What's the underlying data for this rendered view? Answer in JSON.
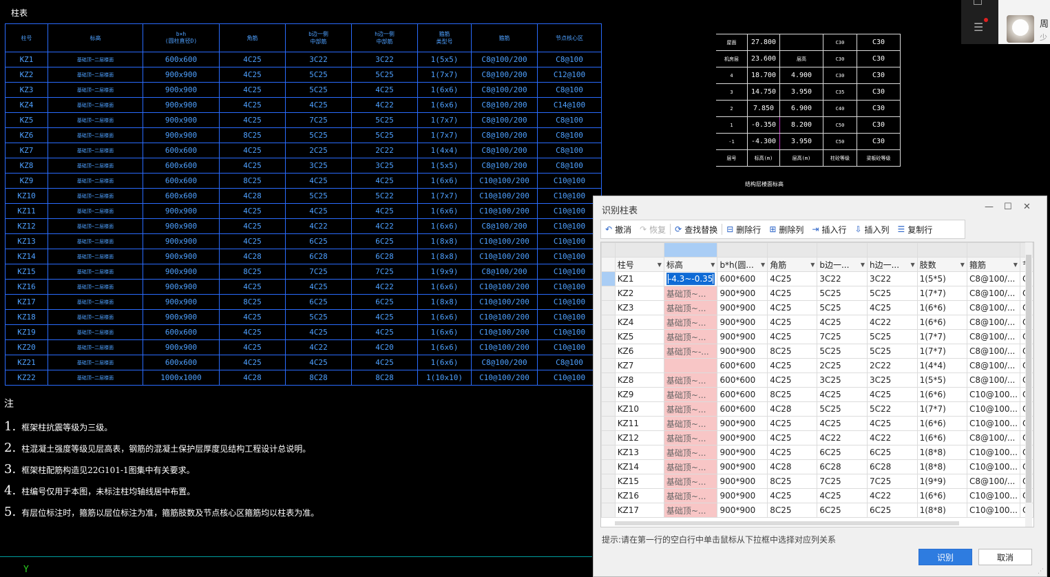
{
  "cad": {
    "title": "柱表",
    "col_headers": [
      "柱号",
      "标高",
      "b×h\n(圆柱直径D)",
      "角筋",
      "b边一侧\n中部筋",
      "h边一侧\n中部筋",
      "箍筋\n类型号",
      "箍筋",
      "节点核心区"
    ],
    "rows": [
      [
        "KZ1",
        "基础顶~二层楼面",
        "600x600",
        "4C25",
        "3C22",
        "3C22",
        "1(5x5)",
        "C8@100/200",
        "C8@100"
      ],
      [
        "KZ2",
        "基础顶~二层楼面",
        "900x900",
        "4C25",
        "5C25",
        "5C25",
        "1(7x7)",
        "C8@100/200",
        "C12@100"
      ],
      [
        "KZ3",
        "基础顶~二层楼面",
        "900x900",
        "4C25",
        "5C25",
        "4C25",
        "1(6x6)",
        "C8@100/200",
        "C8@100"
      ],
      [
        "KZ4",
        "基础顶~二层楼面",
        "900x900",
        "4C25",
        "4C25",
        "4C22",
        "1(6x6)",
        "C8@100/200",
        "C14@100"
      ],
      [
        "KZ5",
        "基础顶~二层楼面",
        "900x900",
        "4C25",
        "7C25",
        "5C25",
        "1(7x7)",
        "C8@100/200",
        "C8@100"
      ],
      [
        "KZ6",
        "基础顶~二层楼面",
        "900x900",
        "8C25",
        "5C25",
        "5C25",
        "1(7x7)",
        "C8@100/200",
        "C8@100"
      ],
      [
        "KZ7",
        "基础顶~二层楼面",
        "600x600",
        "4C25",
        "2C25",
        "2C22",
        "1(4x4)",
        "C8@100/200",
        "C8@100"
      ],
      [
        "KZ8",
        "基础顶~二层楼面",
        "600x600",
        "4C25",
        "3C25",
        "3C25",
        "1(5x5)",
        "C8@100/200",
        "C8@100"
      ],
      [
        "KZ9",
        "基础顶~二层楼面",
        "600x600",
        "8C25",
        "4C25",
        "4C25",
        "1(6x6)",
        "C10@100/200",
        "C10@100"
      ],
      [
        "KZ10",
        "基础顶~二层楼面",
        "600x600",
        "4C28",
        "5C25",
        "5C22",
        "1(7x7)",
        "C10@100/200",
        "C10@100"
      ],
      [
        "KZ11",
        "基础顶~二层楼面",
        "900x900",
        "4C25",
        "4C25",
        "4C25",
        "1(6x6)",
        "C10@100/200",
        "C10@100"
      ],
      [
        "KZ12",
        "基础顶~二层楼面",
        "900x900",
        "4C25",
        "4C22",
        "4C22",
        "1(6x6)",
        "C8@100/200",
        "C10@100"
      ],
      [
        "KZ13",
        "基础顶~二层楼面",
        "900x900",
        "4C25",
        "6C25",
        "6C25",
        "1(8x8)",
        "C10@100/200",
        "C10@100"
      ],
      [
        "KZ14",
        "基础顶~二层楼面",
        "900x900",
        "4C28",
        "6C28",
        "6C28",
        "1(8x8)",
        "C10@100/200",
        "C10@100"
      ],
      [
        "KZ15",
        "基础顶~二层楼面",
        "900x900",
        "8C25",
        "7C25",
        "7C25",
        "1(9x9)",
        "C8@100/200",
        "C10@100"
      ],
      [
        "KZ16",
        "基础顶~二层楼面",
        "900x900",
        "4C25",
        "4C25",
        "4C22",
        "1(6x6)",
        "C10@100/200",
        "C10@100"
      ],
      [
        "KZ17",
        "基础顶~二层楼面",
        "900x900",
        "8C25",
        "6C25",
        "6C25",
        "1(8x8)",
        "C10@100/200",
        "C10@100"
      ],
      [
        "KZ18",
        "基础顶~二层楼面",
        "900x900",
        "4C25",
        "5C25",
        "4C25",
        "1(6x6)",
        "C10@100/200",
        "C10@100"
      ],
      [
        "KZ19",
        "基础顶~二层楼面",
        "600x600",
        "4C25",
        "4C25",
        "4C25",
        "1(6x6)",
        "C10@100/200",
        "C10@100"
      ],
      [
        "KZ20",
        "基础顶~二层楼面",
        "900x900",
        "4C25",
        "4C22",
        "4C20",
        "1(6x6)",
        "C10@100/200",
        "C10@100"
      ],
      [
        "KZ21",
        "基础顶~二层楼面",
        "600x600",
        "4C25",
        "4C25",
        "4C25",
        "1(6x6)",
        "C8@100/200",
        "C8@100"
      ],
      [
        "KZ22",
        "基础顶~二层楼面",
        "1000x1000",
        "4C28",
        "8C28",
        "8C28",
        "1(10x10)",
        "C10@100/200",
        "C10@100"
      ]
    ],
    "notes_title": "注",
    "notes": [
      {
        "num": "1.",
        "text": "框架柱抗震等级为三级。"
      },
      {
        "num": "2.",
        "text": "柱混凝土强度等级见层高表，钢筋的混凝土保护层厚度见结构工程设计总说明。"
      },
      {
        "num": "3.",
        "text": "框架柱配筋构造见22G101-1图集中有关要求。"
      },
      {
        "num": "4.",
        "text": "柱编号仅用于本图，未标注柱均轴线居中布置。"
      },
      {
        "num": "5.",
        "text": "有层位标注时，箍筋以层位标注为准，箍筋肢数及节点核心区箍筋均以柱表为准。"
      }
    ],
    "y_axis_label": "Y",
    "elev_table": {
      "rows": [
        [
          "屋面",
          "27.800",
          "",
          "C30",
          "C30"
        ],
        [
          "机房层",
          "23.600",
          "层高",
          "C30",
          "C30"
        ],
        [
          "4",
          "18.700",
          "4.900",
          "C30",
          "C30"
        ],
        [
          "3",
          "14.750",
          "3.950",
          "C35",
          "C30"
        ],
        [
          "2",
          "7.850",
          "6.900",
          "C40",
          "C30"
        ],
        [
          "1",
          "-0.350",
          "8.200",
          "C50",
          "C30"
        ],
        [
          "-1",
          "-4.300",
          "3.950",
          "C50",
          "C30"
        ],
        [
          "层号",
          "标高(m)",
          "层高(m)",
          "柱砼等级",
          "梁板砼等级"
        ]
      ],
      "caption": "结构层楼面标高"
    }
  },
  "user": {
    "name": "周",
    "sub": "少"
  },
  "dialog": {
    "title": "识别柱表",
    "window_buttons": {
      "minimize": "—",
      "maximize": "☐",
      "close": "✕"
    },
    "toolbar": [
      {
        "label": "撤消",
        "icon": "undo-icon",
        "glyph": "↶",
        "enabled": true
      },
      {
        "label": "恢复",
        "icon": "redo-icon",
        "glyph": "↷",
        "enabled": false
      },
      {
        "label": "查找替换",
        "icon": "find-replace-icon",
        "glyph": "⟳",
        "enabled": true
      },
      {
        "label": "删除行",
        "icon": "delete-row-icon",
        "glyph": "⊟",
        "enabled": true
      },
      {
        "label": "删除列",
        "icon": "delete-column-icon",
        "glyph": "⊞",
        "enabled": true
      },
      {
        "label": "插入行",
        "icon": "insert-row-icon",
        "glyph": "⇥",
        "enabled": true
      },
      {
        "label": "插入列",
        "icon": "insert-column-icon",
        "glyph": "⇩",
        "enabled": true
      },
      {
        "label": "复制行",
        "icon": "copy-row-icon",
        "glyph": "☰",
        "enabled": true
      }
    ],
    "columns": [
      "柱号",
      "标高",
      "b*h(圆...",
      "角筋",
      "b边一...",
      "h边一...",
      "肢数",
      "箍筋",
      "节"
    ],
    "editing_value": "-4.3~-0.35",
    "rows": [
      [
        "KZ1",
        "-4.3~-0.35",
        "600*600",
        "4C25",
        "3C22",
        "3C22",
        "1(5*5)",
        "C8@100/...",
        "C"
      ],
      [
        "KZ2",
        "基础顶~...",
        "900*900",
        "4C25",
        "5C25",
        "5C25",
        "1(7*7)",
        "C8@100/...",
        "C"
      ],
      [
        "KZ3",
        "基础顶~...",
        "900*900",
        "4C25",
        "5C25",
        "4C25",
        "1(6*6)",
        "C8@100/...",
        "C"
      ],
      [
        "KZ4",
        "基础顶~...",
        "900*900",
        "4C25",
        "4C25",
        "4C22",
        "1(6*6)",
        "C8@100/...",
        "C"
      ],
      [
        "KZ5",
        "基础顶~...",
        "900*900",
        "4C25",
        "7C25",
        "5C25",
        "1(7*7)",
        "C8@100/...",
        "C"
      ],
      [
        "KZ6",
        "基础顶~-...",
        "900*900",
        "8C25",
        "5C25",
        "5C25",
        "1(7*7)",
        "C8@100/...",
        "C"
      ],
      [
        "KZ7",
        "",
        "600*600",
        "4C25",
        "2C25",
        "2C22",
        "1(4*4)",
        "C8@100/...",
        "C"
      ],
      [
        "KZ8",
        "基础顶~...",
        "600*600",
        "4C25",
        "3C25",
        "3C25",
        "1(5*5)",
        "C8@100/...",
        "C"
      ],
      [
        "KZ9",
        "基础顶~...",
        "600*600",
        "8C25",
        "4C25",
        "4C25",
        "1(6*6)",
        "C10@100...",
        "C"
      ],
      [
        "KZ10",
        "基础顶~...",
        "600*600",
        "4C28",
        "5C25",
        "5C22",
        "1(7*7)",
        "C10@100...",
        "C"
      ],
      [
        "KZ11",
        "基础顶~...",
        "900*900",
        "4C25",
        "4C25",
        "4C25",
        "1(6*6)",
        "C10@100...",
        "C"
      ],
      [
        "KZ12",
        "基础顶~...",
        "900*900",
        "4C25",
        "4C22",
        "4C22",
        "1(6*6)",
        "C8@100/...",
        "C"
      ],
      [
        "KZ13",
        "基础顶~...",
        "900*900",
        "4C25",
        "6C25",
        "6C25",
        "1(8*8)",
        "C10@100...",
        "C"
      ],
      [
        "KZ14",
        "基础顶~...",
        "900*900",
        "4C28",
        "6C28",
        "6C28",
        "1(8*8)",
        "C10@100...",
        "C"
      ],
      [
        "KZ15",
        "基础顶~...",
        "900*900",
        "8C25",
        "7C25",
        "7C25",
        "1(9*9)",
        "C8@100/...",
        "C"
      ],
      [
        "KZ16",
        "基础顶~...",
        "900*900",
        "4C25",
        "4C25",
        "4C22",
        "1(6*6)",
        "C10@100...",
        "C"
      ],
      [
        "KZ17",
        "基础顶~...",
        "900*900",
        "8C25",
        "6C25",
        "6C25",
        "1(8*8)",
        "C10@100...",
        "C"
      ]
    ],
    "hint": "提示:请在第一行的空白行中单击鼠标从下拉框中选择对应列关系",
    "ok_label": "识别",
    "cancel_label": "取消",
    "colors": {
      "accent": "#2e7ce0",
      "highlight_column": "#f8c6c6",
      "cad_blue": "#4ea0ff"
    }
  }
}
